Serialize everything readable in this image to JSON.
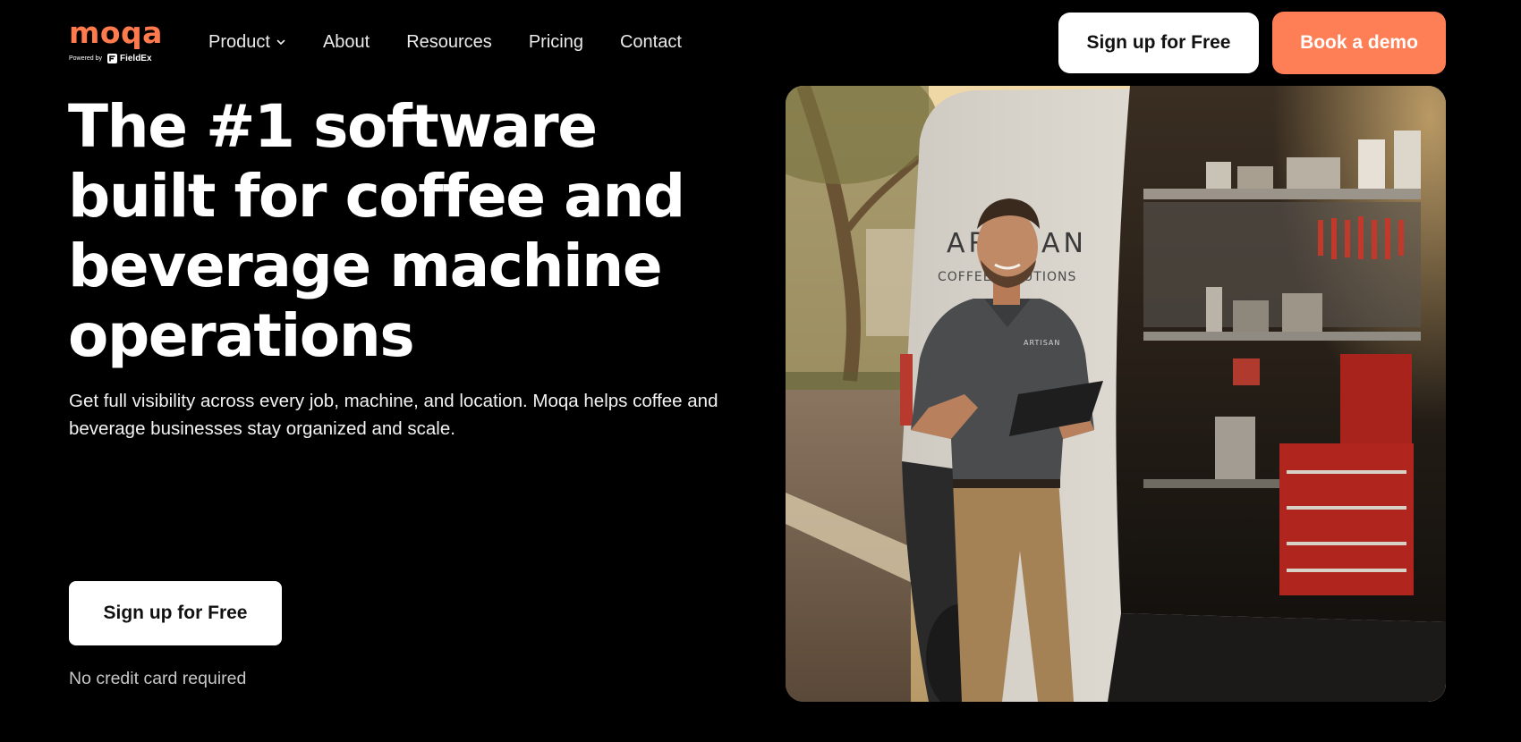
{
  "brand": {
    "name": "moqa",
    "powered_by": "Powered by",
    "partner": "FieldEx",
    "color": "#ff7a4d"
  },
  "nav": {
    "items": [
      {
        "label": "Product",
        "has_dropdown": true,
        "icon": "chevron-down-icon"
      },
      {
        "label": "About"
      },
      {
        "label": "Resources"
      },
      {
        "label": "Pricing"
      },
      {
        "label": "Contact"
      }
    ]
  },
  "header_actions": {
    "signup_label": "Sign up for Free",
    "demo_label": "Book a demo",
    "demo_color": "#fe7f55"
  },
  "hero": {
    "title": "The #1 software built for coffee and beverage machine operations",
    "subtitle": "Get full visibility across every job, machine, and location. Moqa helps coffee and beverage businesses stay organized and scale.",
    "cta_label": "Sign up for Free",
    "note": "No credit card required",
    "image": {
      "van_text_line1": "ARTISAN",
      "van_text_line2": "COFFEE SOLUTIONS",
      "shirt_logo": "ARTISAN"
    }
  },
  "colors": {
    "background": "#000000",
    "text": "#ffffff",
    "muted": "#c8c8c8"
  }
}
